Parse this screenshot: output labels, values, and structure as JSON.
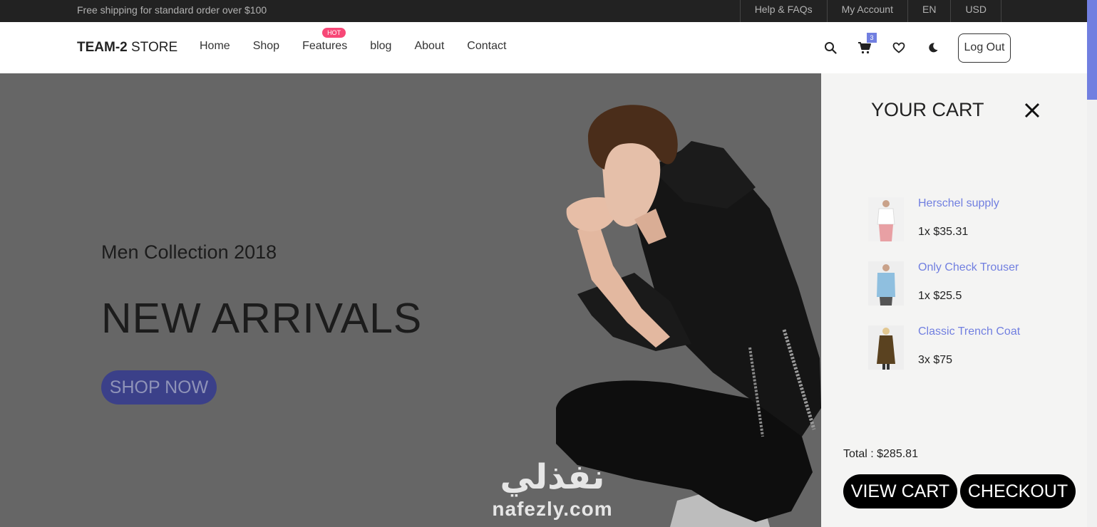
{
  "topbar": {
    "promo": "Free shipping for standard order over $100",
    "links": [
      "Help & FAQs",
      "My Account",
      "EN",
      "USD"
    ]
  },
  "header": {
    "logo_bold": "TEAM-2",
    "logo_rest": " STORE",
    "nav": [
      "Home",
      "Shop",
      "Features",
      "blog",
      "About",
      "Contact"
    ],
    "hot_badge": "HOT",
    "cart_count": "3",
    "logout_label": "Log Out",
    "icons": [
      "search-icon",
      "cart-icon",
      "heart-icon",
      "moon-icon"
    ]
  },
  "hero": {
    "subtitle": "Men Collection 2018",
    "title": "NEW ARRIVALS",
    "button": "SHOP NOW"
  },
  "watermark": {
    "arabic": "نفذلي",
    "latin": "nafezly.com"
  },
  "cart": {
    "title": "YOUR CART",
    "items": [
      {
        "name": "Herschel supply",
        "price": "1x $35.31"
      },
      {
        "name": "Only Check Trouser",
        "price": "1x $25.5"
      },
      {
        "name": "Classic Trench Coat",
        "price": "3x $75"
      }
    ],
    "total": "Total : $285.81",
    "view_label": "VIEW CART",
    "checkout_label": "CHECKOUT"
  },
  "colors": {
    "accent": "#717fe0",
    "hot": "#f74877",
    "topbar": "#222222",
    "overlay": "#666666"
  }
}
